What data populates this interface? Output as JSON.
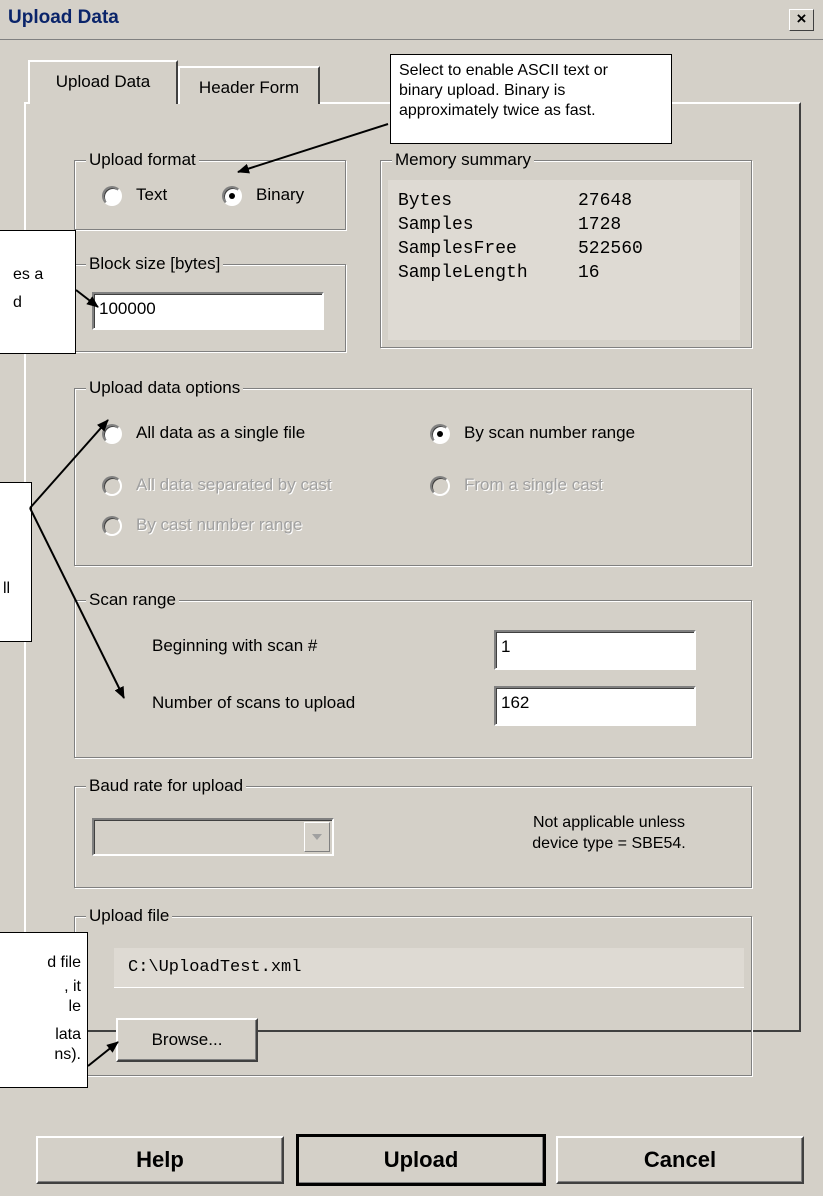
{
  "window": {
    "title": "Upload Data",
    "close": "×"
  },
  "tabs": [
    {
      "label": "Upload Data"
    },
    {
      "label": "Header Form"
    }
  ],
  "upload_format": {
    "legend": "Upload format",
    "options": [
      {
        "label": "Text",
        "selected": false
      },
      {
        "label": "Binary",
        "selected": true
      }
    ]
  },
  "memory_summary": {
    "legend": "Memory summary",
    "rows": [
      {
        "key": "Bytes",
        "value": "27648"
      },
      {
        "key": "Samples",
        "value": "1728"
      },
      {
        "key": "SamplesFree",
        "value": "522560"
      },
      {
        "key": "SampleLength",
        "value": "16"
      }
    ]
  },
  "block_size": {
    "legend": "Block size [bytes]",
    "value": "100000"
  },
  "upload_data_options": {
    "legend": "Upload data options",
    "options": [
      {
        "label": "All data as a single file",
        "selected": false,
        "enabled": true
      },
      {
        "label": "By scan number range",
        "selected": true,
        "enabled": true
      },
      {
        "label": "All data separated by cast",
        "selected": false,
        "enabled": false
      },
      {
        "label": "From a single cast",
        "selected": false,
        "enabled": false
      },
      {
        "label": "By cast number range",
        "selected": false,
        "enabled": false
      }
    ]
  },
  "scan_range": {
    "legend": "Scan range",
    "begin_label": "Beginning with scan #",
    "begin_value": "1",
    "count_label": "Number of scans to upload",
    "count_value": "162"
  },
  "baud_rate": {
    "legend": "Baud rate for upload",
    "selected": "",
    "note_line1": "Not applicable unless",
    "note_line2": "device type = SBE54."
  },
  "upload_file": {
    "legend": "Upload file",
    "path": "C:\\UploadTest.xml",
    "browse_label": "Browse..."
  },
  "buttons": {
    "help": "Help",
    "upload": "Upload",
    "cancel": "Cancel"
  },
  "callouts": {
    "top": [
      "Select to enable ASCII text or",
      "binary upload. Binary is",
      "approximately twice as fast."
    ],
    "left1": [
      "es a",
      "d"
    ],
    "left2": [
      "ll"
    ],
    "left3": [
      "d file",
      ", it",
      "le",
      "lata",
      "ns)."
    ]
  },
  "colors": {
    "face": "#d4d0c8",
    "title_text": "#0a246a",
    "disabled_text": "#a0a0a0"
  }
}
